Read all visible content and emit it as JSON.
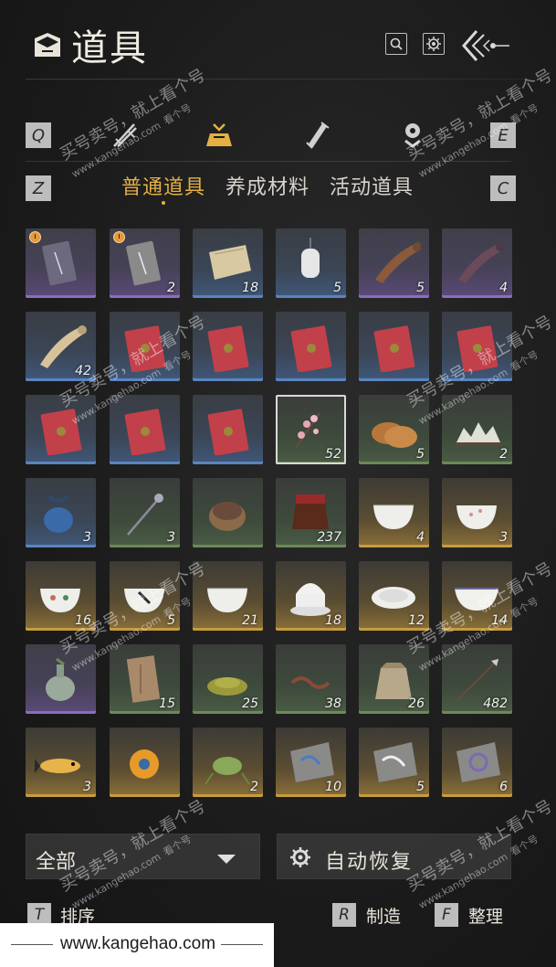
{
  "header": {
    "title": "道具",
    "icons": [
      "bag-icon",
      "search-icon",
      "settings-icon",
      "back-icon"
    ]
  },
  "categories": {
    "left_key": "Q",
    "right_key": "E",
    "items": [
      {
        "icon": "swords-icon",
        "active": false
      },
      {
        "icon": "pouch-icon",
        "active": true
      },
      {
        "icon": "scroll-icon",
        "active": false
      },
      {
        "icon": "location-icon",
        "active": false
      }
    ]
  },
  "tabs": {
    "left_key": "Z",
    "right_key": "C",
    "items": [
      "普通道具",
      "养成材料",
      "活动道具"
    ],
    "active_index": 0
  },
  "items": [
    {
      "name": "purple-ticket",
      "rarity": "purple",
      "count": "",
      "timed": true
    },
    {
      "name": "silver-ticket",
      "rarity": "purple",
      "count": "2",
      "timed": true
    },
    {
      "name": "scroll-paper",
      "rarity": "blue",
      "count": "18",
      "timed": false
    },
    {
      "name": "white-lantern",
      "rarity": "blue",
      "count": "5",
      "timed": false
    },
    {
      "name": "brown-horn",
      "rarity": "purple",
      "count": "5",
      "timed": false
    },
    {
      "name": "dark-horn",
      "rarity": "purple",
      "count": "4",
      "timed": false
    },
    {
      "name": "ivory-horn",
      "rarity": "blue",
      "count": "42",
      "timed": false
    },
    {
      "name": "red-envelope",
      "rarity": "blue",
      "count": "",
      "timed": false
    },
    {
      "name": "red-envelope",
      "rarity": "blue",
      "count": "",
      "timed": false
    },
    {
      "name": "red-envelope",
      "rarity": "blue",
      "count": "",
      "timed": false
    },
    {
      "name": "red-envelope",
      "rarity": "blue",
      "count": "",
      "timed": false
    },
    {
      "name": "red-envelope",
      "rarity": "blue",
      "count": "",
      "timed": false
    },
    {
      "name": "red-envelope",
      "rarity": "blue",
      "count": "",
      "timed": false
    },
    {
      "name": "red-envelope",
      "rarity": "blue",
      "count": "",
      "timed": false
    },
    {
      "name": "red-envelope",
      "rarity": "blue",
      "count": "",
      "timed": false
    },
    {
      "name": "plum-blossom",
      "rarity": "green",
      "count": "52",
      "timed": false,
      "selected": true
    },
    {
      "name": "flatbread",
      "rarity": "green",
      "count": "5",
      "timed": false
    },
    {
      "name": "rock-garden",
      "rarity": "green",
      "count": "2",
      "timed": false
    },
    {
      "name": "blue-sachet",
      "rarity": "blue",
      "count": "3",
      "timed": false
    },
    {
      "name": "hairpin",
      "rarity": "green",
      "count": "3",
      "timed": false
    },
    {
      "name": "lacquer-box",
      "rarity": "green",
      "count": "",
      "timed": false
    },
    {
      "name": "wine-jar",
      "rarity": "green",
      "count": "237",
      "timed": false
    },
    {
      "name": "porcelain-bowl",
      "rarity": "gold",
      "count": "4",
      "timed": false
    },
    {
      "name": "plum-bowl",
      "rarity": "gold",
      "count": "3",
      "timed": false
    },
    {
      "name": "flower-bowl",
      "rarity": "gold",
      "count": "16",
      "timed": false
    },
    {
      "name": "rooster-bowl",
      "rarity": "gold",
      "count": "5",
      "timed": false
    },
    {
      "name": "white-bowl",
      "rarity": "gold",
      "count": "21",
      "timed": false
    },
    {
      "name": "covered-bowl",
      "rarity": "gold",
      "count": "18",
      "timed": false
    },
    {
      "name": "plate",
      "rarity": "gold",
      "count": "12",
      "timed": false
    },
    {
      "name": "rimmed-bowl",
      "rarity": "gold",
      "count": "14",
      "timed": false
    },
    {
      "name": "celadon-vase",
      "rarity": "purple",
      "count": "",
      "timed": false
    },
    {
      "name": "wood-tablet",
      "rarity": "green",
      "count": "15",
      "timed": false
    },
    {
      "name": "tea-powder",
      "rarity": "green",
      "count": "25",
      "timed": false
    },
    {
      "name": "earthworm",
      "rarity": "green",
      "count": "38",
      "timed": false
    },
    {
      "name": "cloth-sack",
      "rarity": "green",
      "count": "26",
      "timed": false
    },
    {
      "name": "arrow",
      "rarity": "green",
      "count": "482",
      "timed": false
    },
    {
      "name": "fish",
      "rarity": "gold",
      "count": "3",
      "timed": false
    },
    {
      "name": "spiky-beetle",
      "rarity": "gold",
      "count": "",
      "timed": false
    },
    {
      "name": "cricket",
      "rarity": "gold",
      "count": "2",
      "timed": false
    },
    {
      "name": "stone-slab-blue",
      "rarity": "gold",
      "count": "10",
      "timed": false
    },
    {
      "name": "stone-slab-white",
      "rarity": "gold",
      "count": "5",
      "timed": false
    },
    {
      "name": "stone-slab-purple",
      "rarity": "gold",
      "count": "6",
      "timed": false
    }
  ],
  "filter": {
    "label": "全部"
  },
  "auto_restore": {
    "label": "自动恢复"
  },
  "bottom": {
    "sort": {
      "key": "T",
      "label": "排序"
    },
    "craft": {
      "key": "R",
      "label": "制造"
    },
    "organize": {
      "key": "F",
      "label": "整理"
    }
  },
  "watermark": {
    "site": "www.kangehao.com",
    "text1": "买号卖号，就上看个号",
    "text2": "www.kangehao.com",
    "text3": "看个号"
  }
}
